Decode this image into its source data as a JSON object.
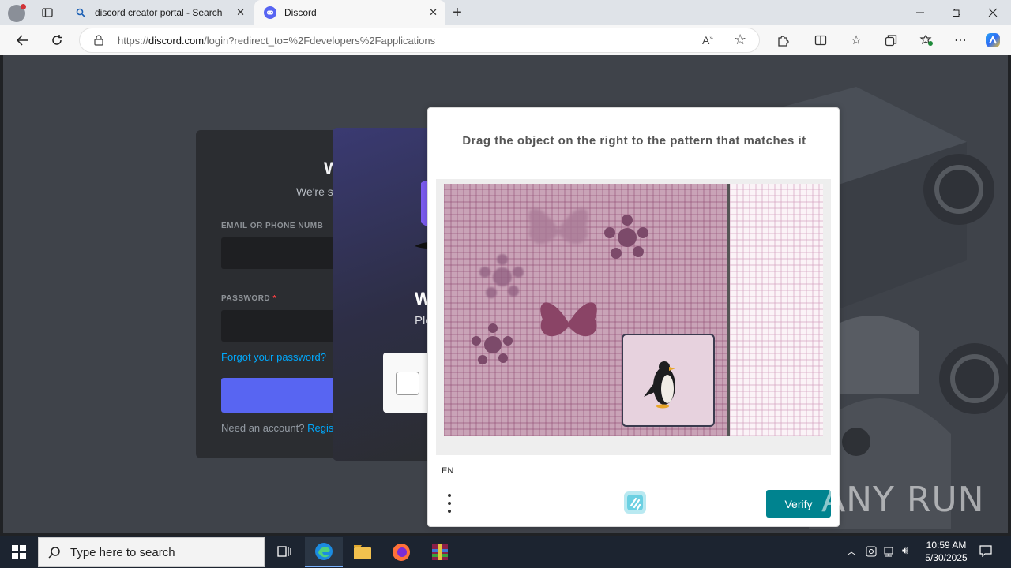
{
  "browser": {
    "tabs": [
      {
        "title": "discord creator portal - Search",
        "icon": "search-icon"
      },
      {
        "title": "Discord",
        "icon": "discord-icon",
        "active": true
      }
    ],
    "url_prefix": "https://",
    "url_host": "discord.com",
    "url_path": "/login?redirect_to=%2Fdevelopers%2Fapplications"
  },
  "page": {
    "login_card": {
      "heading": "W",
      "subheading": "We're s",
      "email_label": "EMAIL OR PHONE NUMB",
      "password_label": "PASSWORD",
      "password_required": "*",
      "forgot": "Forgot your password?",
      "need_account": "Need an account?",
      "register": "Regis"
    },
    "qr_card": {
      "heading": "W",
      "subheading": "Ple"
    }
  },
  "captcha": {
    "title": "Drag the object on the right to the pattern that matches it",
    "language": "EN",
    "verify_label": "Verify",
    "brand_color": "#00838f"
  },
  "watermark": "ANY RUN",
  "taskbar": {
    "search_placeholder": "Type here to search",
    "time": "10:59 AM",
    "date": "5/30/2025"
  }
}
